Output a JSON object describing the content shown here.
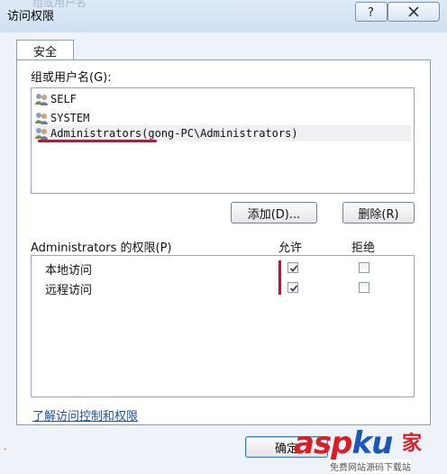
{
  "window": {
    "title": "访问权限",
    "ghost_title": "组或用户名",
    "help_glyph": "?",
    "close_glyph": "✕"
  },
  "tabs": [
    {
      "label": "安全",
      "selected": true
    }
  ],
  "groups": {
    "label": "组或用户名(G):",
    "items": [
      {
        "name": "SELF",
        "detail": ""
      },
      {
        "name": "SYSTEM",
        "detail": ""
      },
      {
        "name": "Administrators",
        "detail": " (gong-PC\\Administrators)"
      }
    ],
    "add_button": "添加(D)...",
    "remove_button": "删除(R)"
  },
  "permissions": {
    "label": "Administrators 的权限(P)",
    "allow_header": "允许",
    "deny_header": "拒绝",
    "rows": [
      {
        "name": "本地访问",
        "allow": true,
        "deny": false
      },
      {
        "name": "远程访问",
        "allow": true,
        "deny": false
      }
    ]
  },
  "learn_link": "了解访问控制和权限",
  "footer": {
    "ok_button": "确定"
  },
  "watermark": {
    "logo_a": "asp",
    "logo_b": "ku",
    "logo_cn": "家",
    "tagline": "免费网站源码下载站"
  },
  "colors": {
    "accent": "#c8102e",
    "link": "#1f4fa8",
    "panel_border": "#8c9bb0"
  }
}
